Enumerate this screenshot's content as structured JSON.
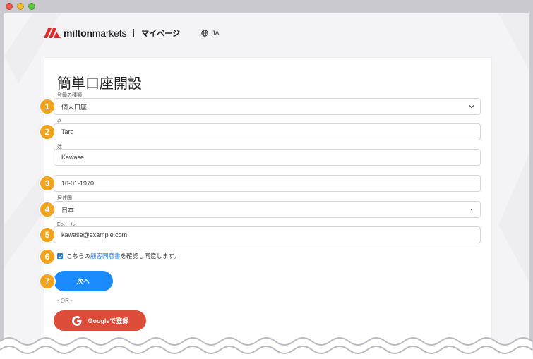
{
  "window": {
    "controls": [
      "close",
      "minimize",
      "maximize"
    ]
  },
  "header": {
    "logo_bold": "milton",
    "logo_light": "markets",
    "mypage": "マイページ",
    "lang": "JA",
    "globe_icon": "globe-icon"
  },
  "form": {
    "title": "簡単口座開設",
    "account_type": {
      "label": "登録の種類",
      "value": "個人口座"
    },
    "first_name": {
      "label": "名",
      "value": "Taro"
    },
    "last_name": {
      "label": "姓",
      "value": "Kawase"
    },
    "birthdate": {
      "value": "10-01-1970"
    },
    "residence": {
      "label": "居住国",
      "value": "日本"
    },
    "email": {
      "label": "Eメール",
      "value": "kawase@example.com"
    },
    "consent": {
      "before": "こちらの",
      "link": "顧客同意書",
      "after": "を確認し同意します。",
      "checked": true
    },
    "next_label": "次へ",
    "or_label": "- OR -",
    "google_label": "Googleで登録"
  },
  "steps": [
    "1",
    "2",
    "3",
    "4",
    "5",
    "6",
    "7"
  ],
  "colors": {
    "accent": "#1a8cff",
    "badge": "#f2a31d",
    "google": "#dd4b39",
    "logo_red": "#e32b2b"
  }
}
